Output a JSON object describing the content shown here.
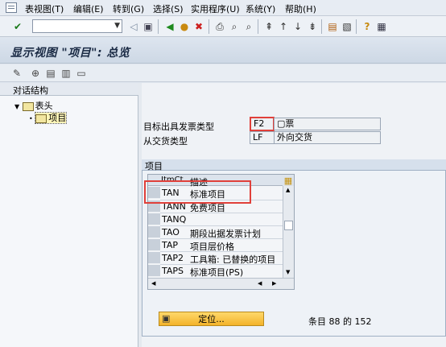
{
  "menu": {
    "items": [
      "表视图(T)",
      "编辑(E)",
      "转到(G)",
      "选择(S)",
      "实用程序(U)",
      "系统(Y)",
      "帮助(H)"
    ]
  },
  "page_title": "显示视图 \"项目\": 总览",
  "tree": {
    "header": "对话结构",
    "root_label": "表头",
    "child_label": "项目"
  },
  "fields": {
    "target_type_label": "目标出具发票类型",
    "target_type_code": "F2",
    "target_type_desc": "票",
    "source_type_label": "从交货类型",
    "source_type_code": "LF",
    "source_type_desc": "外向交货"
  },
  "group": {
    "title": "项目"
  },
  "table": {
    "col_code": "ItmCt",
    "col_desc": "描述",
    "rows": [
      {
        "code": "TAN",
        "desc": "标准项目"
      },
      {
        "code": "TANN",
        "desc": "免费项目"
      },
      {
        "code": "TANQ",
        "desc": ""
      },
      {
        "code": "TAO",
        "desc": "期段出据发票计划"
      },
      {
        "code": "TAP",
        "desc": "项目层价格"
      },
      {
        "code": "TAP2",
        "desc": "工具箱: 已替换的项目"
      },
      {
        "code": "TAPS",
        "desc": "标准项目(PS)"
      }
    ]
  },
  "locate_button": "定位...",
  "entry_count": "条目 88 的 152",
  "colors": {
    "highlight": "#e0403a",
    "button": "#f3b32a"
  }
}
